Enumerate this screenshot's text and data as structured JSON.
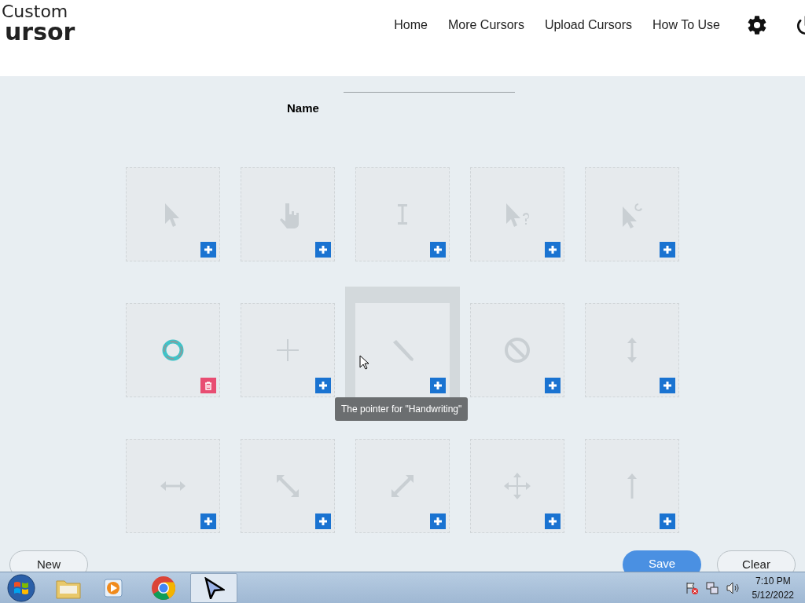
{
  "logo": {
    "line_1": "Custom",
    "line_2": "ursor"
  },
  "nav": [
    {
      "label": "Home"
    },
    {
      "label": "More Cursors"
    },
    {
      "label": "Upload Cursors"
    },
    {
      "label": "How To Use"
    }
  ],
  "name_field": {
    "label": "Name"
  },
  "tiles": [
    {
      "filled": false,
      "hovered": false
    },
    {
      "filled": false,
      "hovered": false
    },
    {
      "filled": false,
      "hovered": false
    },
    {
      "filled": false,
      "hovered": false
    },
    {
      "filled": false,
      "hovered": false
    },
    {
      "filled": true,
      "hovered": false
    },
    {
      "filled": false,
      "hovered": false
    },
    {
      "filled": false,
      "hovered": true
    },
    {
      "filled": false,
      "hovered": false
    },
    {
      "filled": false,
      "hovered": false
    },
    {
      "filled": false,
      "hovered": false
    },
    {
      "filled": false,
      "hovered": false
    },
    {
      "filled": false,
      "hovered": false
    },
    {
      "filled": false,
      "hovered": false
    },
    {
      "filled": false,
      "hovered": false
    }
  ],
  "tooltip": "The pointer for \"Handwriting\"",
  "buttons": [
    {
      "label": "New",
      "kind": "outline"
    },
    {
      "label": "Save",
      "kind": "primary"
    },
    {
      "label": "Clear",
      "kind": "outline"
    }
  ],
  "taskbar": {
    "time": "7:10 PM",
    "date": "5/12/2022"
  }
}
